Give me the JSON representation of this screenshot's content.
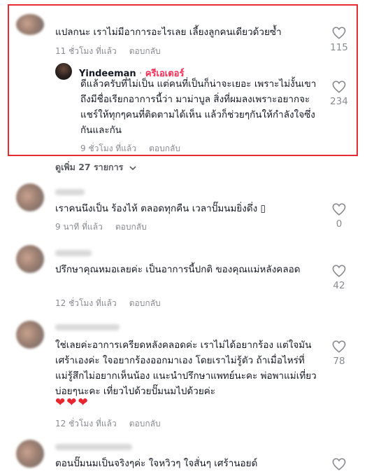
{
  "comments": [
    {
      "text": "แปลกนะ เราไม่มีอาการอะไรเลย เลี้ยงลูกคนเดียวด้วยซ้ำ",
      "time": "11 ชั่วโมง ที่แล้ว",
      "reply_label": "ตอบกลับ",
      "likes": "115"
    },
    {
      "text": "เราคนนึงเป็น ร้องไห้ ตลอดทุกคืน เวลาปั๊มนมยิ่งดึ่ง ▯",
      "time": "9 นาที ที่แล้ว",
      "reply_label": "ตอบกลับ",
      "likes": "0"
    },
    {
      "text": "ปรึกษาคุณหมอเลยค่ะ เป็นอาการนี้ปกติ ของคุณแม่หลังคลอด",
      "time": "12 ชั่วโมง ที่แล้ว",
      "reply_label": "ตอบกลับ",
      "likes": "42"
    },
    {
      "text": "ใช่เลยค่ะอาการเครียดหลังคลอดค่ะ เราไม่ได้อยากร้อง แต่ใจมันเศร้าเองค่ะ ใจอยากร้องออกมาเอง โดยเราไม่รู้ตัว ถ้าเมื่อไหร่ที่แม่รู้สึกไม่อยากเห็นน้อง แนะนำปรึกษาแพทย์นะคะ พ่อพาแม่เที่ยวบ่อยๆนะคะ เที่ยวไปด้วยปั๊มนมไปด้วยค่ะ",
      "emoji": "❤❤❤",
      "time": "12 ชั่วโมง ที่แล้ว",
      "reply_label": "ตอบกลับ",
      "likes": "78"
    },
    {
      "text": "ตอนปั๊มนมเป็นจริงๆค่ะ ใจหวิวๆ ใจสั่นๆ เศร้านอยด์"
    }
  ],
  "creator_reply": {
    "username": "Yindeeman",
    "separator": "·",
    "badge": "ครีเอเตอร์",
    "text": "ดีแล้วครับที่ไม่เป็น แต่คนที่เป็นก็น่าจะเยอะ เพราะไม่งั้นเขาถึงมีชื่อเรียกอาการนี้ว่า มาม่าบูล สิ่งที่ผมลงเพราะอยากจะแชร์ให้ทุกๆคนที่ติดตามได้เห็น แล้วก็ช่วยๆกันให้กำลังใจซึ่งกันและกัน",
    "time": "9 ชั่วโมง ที่แล้ว",
    "reply_label": "ตอบกลับ",
    "likes": "234"
  },
  "view_more": {
    "label": "ดูเพิ่ม 27 รายการ",
    "icon": "chevron-down-icon"
  },
  "colors": {
    "highlight_border": "#e52c34",
    "creator_badge": "#fe2c55",
    "heart_emoji": "#e8262f",
    "muted_text": "#8a8b91"
  }
}
